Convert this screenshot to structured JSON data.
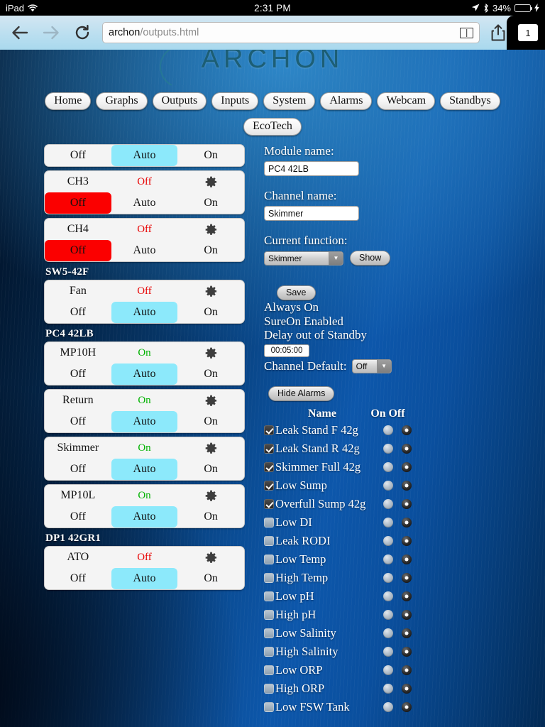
{
  "statusbar": {
    "device": "iPad",
    "wifi_icon": "wifi-icon",
    "time": "2:31 PM",
    "location_icon": "location-arrow-icon",
    "bluetooth_icon": "bluetooth-icon",
    "battery_percent": "34%",
    "battery_level": 34,
    "charging_icon": "lightning-bolt-icon"
  },
  "browser": {
    "back_icon": "back-arrow-icon",
    "forward_icon": "forward-arrow-icon",
    "reload_icon": "reload-icon",
    "url_host": "archon",
    "url_path": "/outputs.html",
    "reader_icon": "reader-view-icon",
    "share_icon": "share-icon",
    "bookmark_icon": "bookmark-star-icon",
    "tab_count": "1"
  },
  "site": {
    "logo_text": "ARCHON",
    "nav_primary": [
      "Home",
      "Graphs",
      "Outputs",
      "Inputs",
      "System",
      "Alarms",
      "Webcam",
      "Standbys"
    ],
    "nav_secondary": [
      "EcoTech"
    ]
  },
  "channel_list": [
    {
      "kind": "card",
      "name": "",
      "state": "",
      "state_class": "",
      "partial_top": true,
      "segments": [
        "Off",
        "Auto",
        "On"
      ],
      "selected": "Auto"
    },
    {
      "kind": "card",
      "name": "CH3",
      "state": "Off",
      "state_class": "off",
      "segments": [
        "Off",
        "Auto",
        "On"
      ],
      "selected": "Off"
    },
    {
      "kind": "card",
      "name": "CH4",
      "state": "Off",
      "state_class": "off",
      "segments": [
        "Off",
        "Auto",
        "On"
      ],
      "selected": "Off"
    },
    {
      "kind": "group",
      "label": "SW5-42F"
    },
    {
      "kind": "card",
      "name": "Fan",
      "state": "Off",
      "state_class": "off",
      "segments": [
        "Off",
        "Auto",
        "On"
      ],
      "selected": "Auto"
    },
    {
      "kind": "group",
      "label": "PC4 42LB"
    },
    {
      "kind": "card",
      "name": "MP10H",
      "state": "On",
      "state_class": "on",
      "segments": [
        "Off",
        "Auto",
        "On"
      ],
      "selected": "Auto"
    },
    {
      "kind": "card",
      "name": "Return",
      "state": "On",
      "state_class": "on",
      "segments": [
        "Off",
        "Auto",
        "On"
      ],
      "selected": "Auto"
    },
    {
      "kind": "card",
      "name": "Skimmer",
      "state": "On",
      "state_class": "on",
      "segments": [
        "Off",
        "Auto",
        "On"
      ],
      "selected": "Auto"
    },
    {
      "kind": "card",
      "name": "MP10L",
      "state": "On",
      "state_class": "on",
      "segments": [
        "Off",
        "Auto",
        "On"
      ],
      "selected": "Auto"
    },
    {
      "kind": "group",
      "label": "DP1 42GR1"
    },
    {
      "kind": "card",
      "name": "ATO",
      "state": "Off",
      "state_class": "off",
      "segments": [
        "Off",
        "Auto",
        "On"
      ],
      "selected": "Auto"
    }
  ],
  "detail": {
    "module_name_label": "Module name:",
    "module_name_value": "PC4 42LB",
    "channel_name_label": "Channel name:",
    "channel_name_value": "Skimmer",
    "current_function_label": "Current function:",
    "current_function_value": "Skimmer",
    "show_button": "Show",
    "save_button": "Save",
    "option_always_on": "Always On",
    "option_sureon": "SureOn Enabled",
    "option_delay": "Delay out of Standby",
    "delay_value": "00:05:00",
    "channel_default_label": "Channel Default:",
    "channel_default_value": "Off",
    "hide_alarms_button": "Hide Alarms",
    "gear_icon": "gear-icon",
    "dropdown_icon": "chevron-down-icon"
  },
  "alarms": {
    "header_name": "Name",
    "header_on": "On",
    "header_off": "Off",
    "rows": [
      {
        "name": "Leak Stand F 42g",
        "checked": true,
        "selected": "off"
      },
      {
        "name": "Leak Stand R 42g",
        "checked": true,
        "selected": "off"
      },
      {
        "name": "Skimmer Full 42g",
        "checked": true,
        "selected": "off"
      },
      {
        "name": "Low Sump",
        "checked": true,
        "selected": "off"
      },
      {
        "name": "Overfull Sump 42g",
        "checked": true,
        "selected": "off"
      },
      {
        "name": "Low DI",
        "checked": false,
        "selected": "off"
      },
      {
        "name": "Leak RODI",
        "checked": false,
        "selected": "off"
      },
      {
        "name": "Low Temp",
        "checked": false,
        "selected": "off"
      },
      {
        "name": "High Temp",
        "checked": false,
        "selected": "off"
      },
      {
        "name": "Low pH",
        "checked": false,
        "selected": "off"
      },
      {
        "name": "High pH",
        "checked": false,
        "selected": "off"
      },
      {
        "name": "Low Salinity",
        "checked": false,
        "selected": "off"
      },
      {
        "name": "High Salinity",
        "checked": false,
        "selected": "off"
      },
      {
        "name": "Low ORP",
        "checked": false,
        "selected": "off"
      },
      {
        "name": "High ORP",
        "checked": false,
        "selected": "off"
      },
      {
        "name": "Low FSW Tank",
        "checked": false,
        "selected": "off"
      }
    ]
  },
  "colors": {
    "auto_selected": "#8ce9fb",
    "off_selected": "#fb0000",
    "state_on": "#00b200",
    "state_off": "#e80000",
    "battery": "#4cd964"
  }
}
